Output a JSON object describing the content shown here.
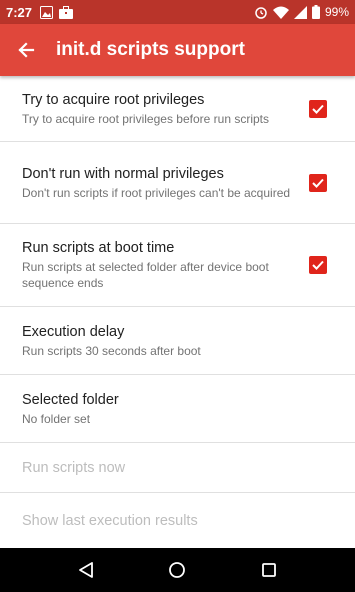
{
  "status_bar": {
    "time": "7:27",
    "battery": "99%",
    "icons": [
      "image-icon",
      "briefcase-icon",
      "alarm-icon",
      "wifi-icon",
      "signal-icon",
      "battery-icon"
    ]
  },
  "app_bar": {
    "title": "init.d scripts support",
    "back_icon": "arrow-left-icon",
    "color": "#e0473b"
  },
  "settings": [
    {
      "title": "Try to acquire root privileges",
      "summary": "Try to acquire root privileges before run scripts",
      "checked": true,
      "enabled": true
    },
    {
      "title": "Don't run with normal privileges",
      "summary": "Don't run scripts if root privileges can't be acquired",
      "checked": true,
      "enabled": true
    },
    {
      "title": "Run scripts at boot time",
      "summary": "Run scripts at selected folder after device boot sequence ends",
      "checked": true,
      "enabled": true
    },
    {
      "title": "Execution delay",
      "summary": "Run scripts 30 seconds after boot",
      "enabled": true
    },
    {
      "title": "Selected folder",
      "summary": "No folder set",
      "enabled": true
    },
    {
      "title": "Run scripts now",
      "enabled": false
    },
    {
      "title": "Show last execution results",
      "enabled": false
    }
  ],
  "nav_bar": {
    "icons": [
      "back-triangle-icon",
      "home-circle-icon",
      "recents-square-icon"
    ]
  },
  "colors": {
    "accent": "#e0251b",
    "status_bar": "#b9342a",
    "disabled_text": "#bdbdbd"
  }
}
